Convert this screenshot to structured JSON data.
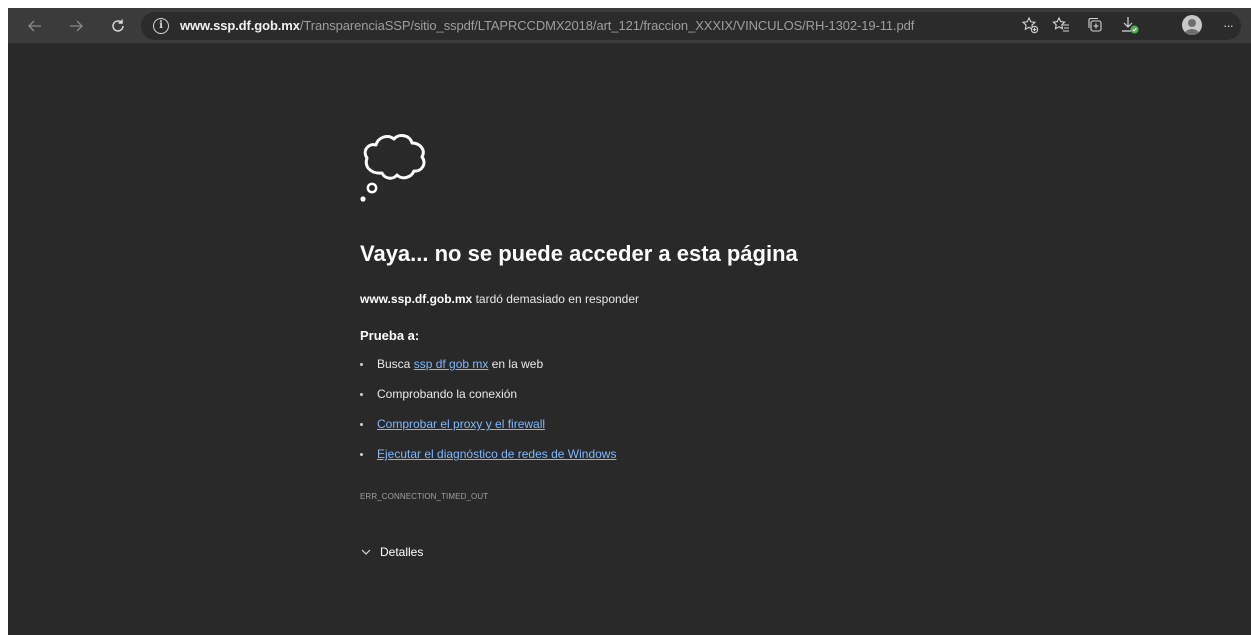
{
  "browser": {
    "url_host": "www.ssp.df.gob.mx",
    "url_path": "/TransparenciaSSP/sitio_sspdf/LTAPRCCDMX2018/art_121/fraccion_XXXIX/VINCULOS/RH-1302-19-11.pdf",
    "more_label": "···",
    "icons": [
      "back-arrow-icon",
      "forward-arrow-icon",
      "refresh-icon",
      "info-icon",
      "add-favorite-icon",
      "favorites-icon",
      "collections-icon",
      "downloads-icon",
      "profile-avatar",
      "more-icon"
    ]
  },
  "error_page": {
    "icon": "thought-cloud-icon",
    "title": "Vaya... no se puede acceder a esta página",
    "host": "www.ssp.df.gob.mx",
    "message_suffix": "tardó demasiado en responder",
    "try_heading": "Prueba a:",
    "suggestions": {
      "search_prefix": "Busca",
      "search_link": "ssp df gob mx",
      "search_suffix": "en la web",
      "check_connection": "Comprobando la conexión",
      "proxy_firewall": "Comprobar el proxy y el firewall",
      "network_diagnostics": "Ejecutar el diagnóstico de redes de Windows"
    },
    "error_code": "ERR_CONNECTION_TIMED_OUT",
    "details_label": "Detalles"
  },
  "colors": {
    "page_bg": "#292929",
    "toolbar_bg": "#3b3b3b",
    "link": "#7eb8ff",
    "download_ok": "#4caf50"
  }
}
